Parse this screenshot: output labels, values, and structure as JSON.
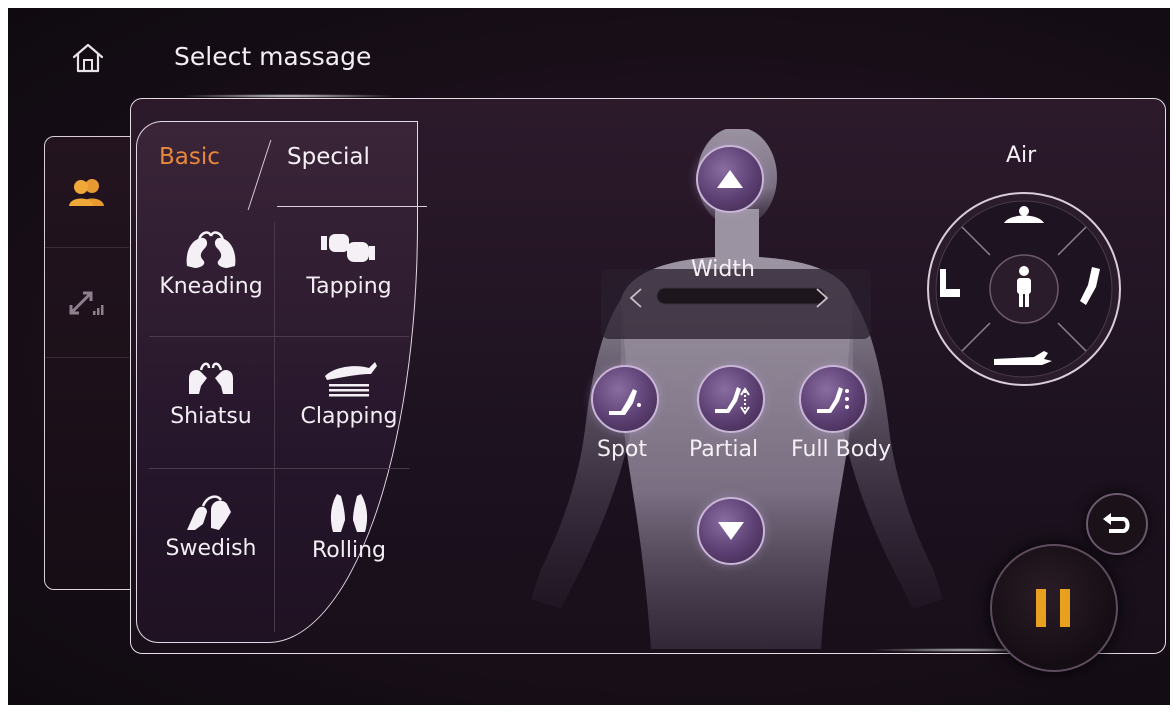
{
  "header": {
    "title": "Select massage",
    "home_icon": "home-icon"
  },
  "sidebar": {
    "items": [
      {
        "icon": "users-icon",
        "active": true
      },
      {
        "icon": "adjust-signal-icon",
        "active": false
      }
    ]
  },
  "tabs": {
    "basic": "Basic",
    "special": "Special",
    "active": "Basic"
  },
  "techniques": [
    {
      "label": "Kneading",
      "icon": "kneading-hands-icon"
    },
    {
      "label": "Tapping",
      "icon": "tapping-fists-icon"
    },
    {
      "label": "Shiatsu",
      "icon": "shiatsu-thumbs-icon"
    },
    {
      "label": "Clapping",
      "icon": "clapping-hand-icon"
    },
    {
      "label": "Swedish",
      "icon": "swedish-hands-icon"
    },
    {
      "label": "Rolling",
      "icon": "rolling-hands-icon"
    }
  ],
  "width": {
    "label": "Width"
  },
  "modes": [
    {
      "label": "Spot",
      "icon": "spot-massage-icon"
    },
    {
      "label": "Partial",
      "icon": "partial-massage-icon"
    },
    {
      "label": "Full Body",
      "icon": "fullbody-massage-icon"
    }
  ],
  "air": {
    "title": "Air",
    "zones": [
      "shoulder-icon",
      "arm-icon",
      "body-icon",
      "legs-icon",
      "hand-icon"
    ]
  },
  "colors": {
    "accent": "#e8883a",
    "pause": "#e8a020",
    "text": "#f5f0f5"
  }
}
